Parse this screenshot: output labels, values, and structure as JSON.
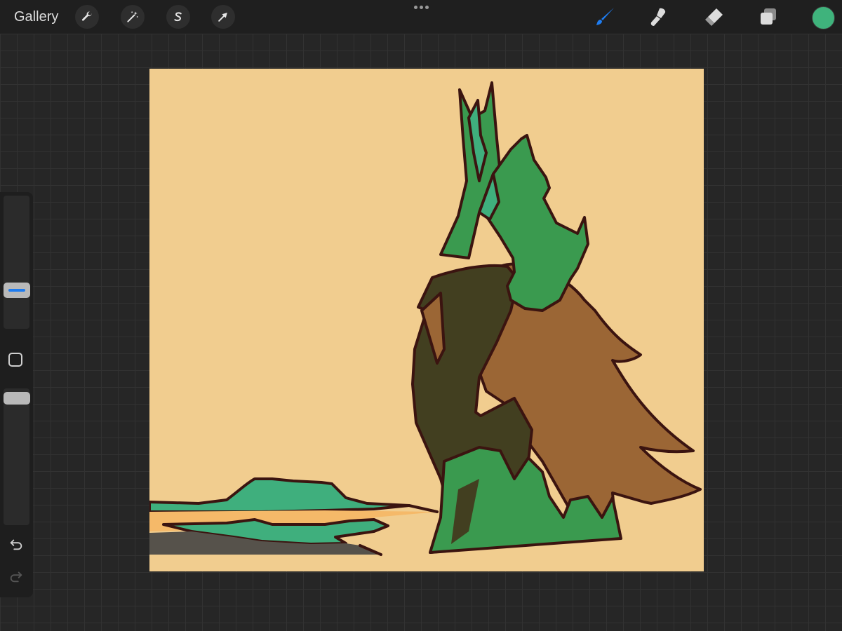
{
  "app": {
    "gallery_label": "Gallery"
  },
  "toolbar_left": [
    {
      "name": "actions-wrench-icon"
    },
    {
      "name": "adjustments-magic-wand-icon"
    },
    {
      "name": "selection-s-icon"
    },
    {
      "name": "transform-arrow-icon"
    }
  ],
  "toolbar_right": {
    "active_tool": "brush",
    "tools": [
      "brush-icon",
      "smudge-icon",
      "eraser-icon",
      "layers-icon"
    ],
    "current_color": "#3fb37c",
    "active_color": "#1e7cf0"
  },
  "sidebar": {
    "brush_size_level": 0.25,
    "opacity_level": 0.1,
    "buttons": [
      "modify-square-button",
      "undo-button",
      "redo-button"
    ]
  },
  "artwork": {
    "background_color": "#f1cd8f",
    "outline_color": "#3b1410",
    "palette": {
      "green": "#3a9a4f",
      "teal": "#3faf7d",
      "dark_olive": "#423f20",
      "brown": "#9b6635",
      "light_orange": "#f5b969",
      "slate": "#56524b"
    }
  }
}
